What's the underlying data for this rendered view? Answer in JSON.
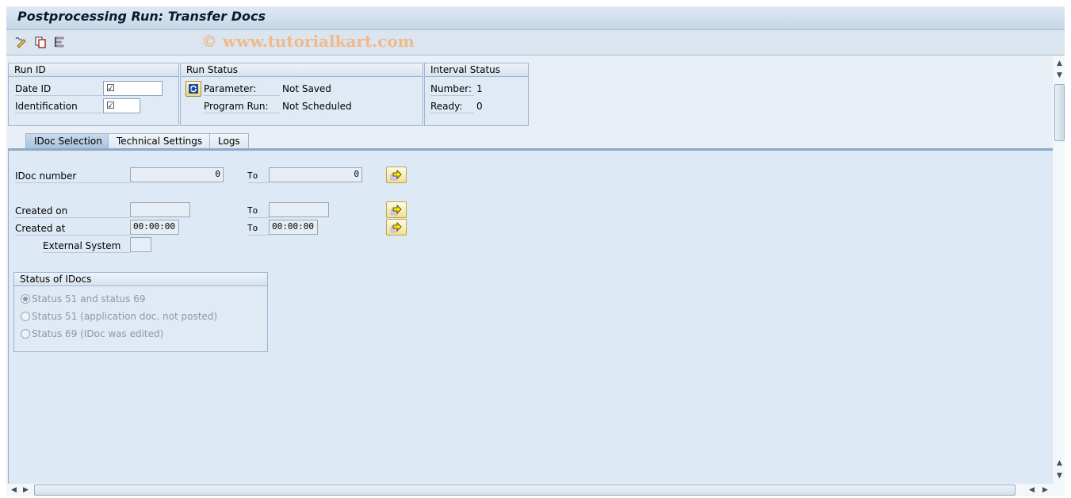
{
  "window": {
    "title": "Postprocessing Run: Transfer Docs"
  },
  "toolbar": {
    "icons": [
      "change-icon",
      "copy-icon",
      "hierarchy-icon"
    ],
    "watermark": "© www.tutorialkart.com"
  },
  "run_id": {
    "header": "Run ID",
    "date_id_label": "Date ID",
    "date_id_value": "☑",
    "identification_label": "Identification",
    "identification_value": "☑"
  },
  "run_status": {
    "header": "Run Status",
    "parameter_label": "Parameter:",
    "parameter_value": "Not Saved",
    "program_run_label": "Program Run:",
    "program_run_value": "Not Scheduled"
  },
  "interval_status": {
    "header": "Interval Status",
    "number_label": "Number:",
    "number_value": "1",
    "ready_label": "Ready:",
    "ready_value": "0"
  },
  "tabs": [
    {
      "label": "IDoc Selection",
      "active": true
    },
    {
      "label": "Technical Settings",
      "active": false
    },
    {
      "label": "Logs",
      "active": false
    }
  ],
  "selection": {
    "idoc_number_label": "IDoc number",
    "idoc_from": "0",
    "idoc_to_label": "To",
    "idoc_to": "0",
    "created_on_label": "Created on",
    "created_on_from": "",
    "created_on_to_label": "To",
    "created_on_to": "",
    "created_at_label": "Created at",
    "created_at_from": "00:00:00",
    "created_at_to_label": "To",
    "created_at_to": "00:00:00",
    "external_system_label": "External System",
    "external_system_value": ""
  },
  "status_of_idocs": {
    "header": "Status of IDocs",
    "options": [
      {
        "label": "Status 51 and status 69",
        "selected": true
      },
      {
        "label": "Status 51 (application doc. not posted)",
        "selected": false
      },
      {
        "label": "Status 69 (IDoc was edited)",
        "selected": false
      }
    ]
  }
}
